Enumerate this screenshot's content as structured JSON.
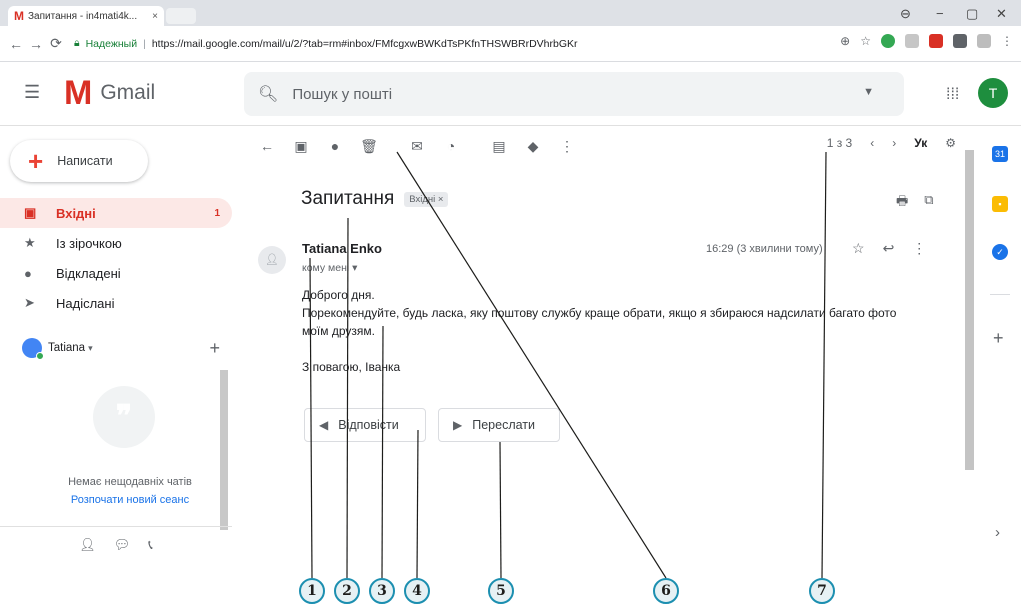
{
  "browser": {
    "tab_title": "Запитання - in4mati4k...",
    "tab_close": "×",
    "secure_label": "Надежный",
    "url": "https://mail.google.com/mail/u/2/?tab=rm#inbox/FMfcgxwBWKdTsPKfnTHSWBRrDVhrbGKr",
    "window_controls": [
      "−",
      "▢",
      "✕"
    ]
  },
  "header": {
    "app_name": "Gmail",
    "search_placeholder": "Пошук у пошті",
    "avatar_letter": "T"
  },
  "sidebar": {
    "compose_label": "Написати",
    "items": [
      {
        "label": "Вхідні",
        "count": "1",
        "active": true
      },
      {
        "label": "Із зірочкою",
        "count": ""
      },
      {
        "label": "Відкладені",
        "count": ""
      },
      {
        "label": "Надіслані",
        "count": ""
      }
    ],
    "hangouts_user": "Tatiana",
    "no_recent_chats": "Немає нещодавніх чатів",
    "start_new_session": "Розпочати новий сеанс"
  },
  "toolbar": {
    "pagination": "1 з 3",
    "language": "Ук"
  },
  "message": {
    "subject": "Запитання",
    "label_chip": "Вхідні ×",
    "sender": "Tatiana Enko",
    "to_me": "кому мені",
    "time": "16:29 (3 хвилини тому)",
    "body": {
      "greeting": "Доброго дня.",
      "line1": "Порекомендуйте, будь ласка, яку поштову службу краще обрати, якщо я збираюся надсилати багато фото",
      "line2": "моїм друзям.",
      "signoff": "З повагою, Іванка"
    },
    "reply_label": "Відповісти",
    "forward_label": "Переслати"
  },
  "callouts": [
    "1",
    "2",
    "3",
    "4",
    "5",
    "6",
    "7"
  ],
  "colors": {
    "gmail_red": "#d93025",
    "active_bg": "#fce8e6",
    "callout_border": "#1c8fb0",
    "avatar_green": "#1e8e3e"
  }
}
